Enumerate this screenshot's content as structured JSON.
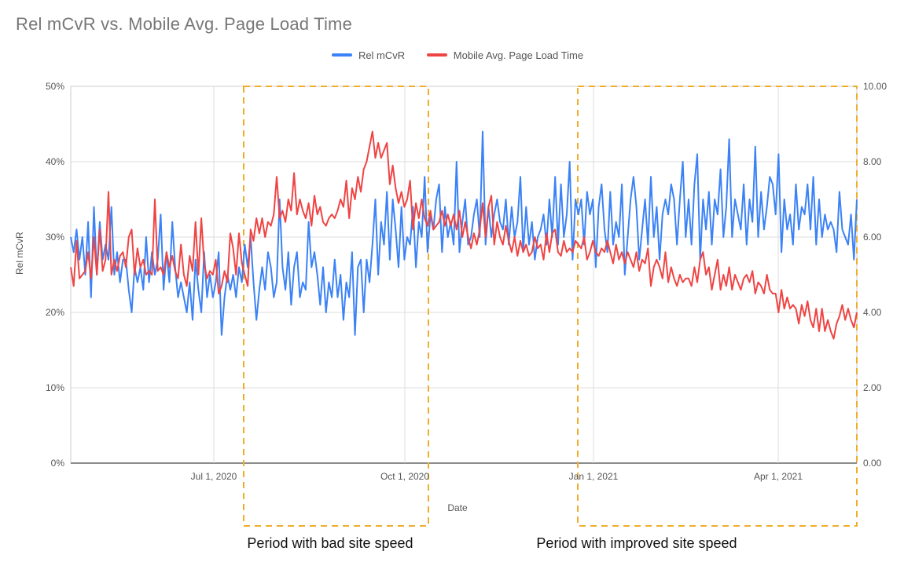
{
  "chart_data": {
    "type": "line",
    "title": "Rel mCvR vs. Mobile Avg. Page Load Time",
    "xlabel": "Date",
    "ylabel": "Rel mCvR",
    "y2label": "",
    "x_ticks": [
      "Jul 1, 2020",
      "Oct 1, 2020",
      "Jan 1, 2021",
      "Apr 1, 2021"
    ],
    "x_tick_pos": [
      0.182,
      0.425,
      0.665,
      0.9
    ],
    "y_ticks": [
      "0%",
      "10%",
      "20%",
      "30%",
      "40%",
      "50%"
    ],
    "ylim": [
      0,
      50
    ],
    "y2_ticks": [
      "0.00",
      "2.00",
      "4.00",
      "6.00",
      "8.00",
      "10.00"
    ],
    "y2lim": [
      0,
      10
    ],
    "legend": [
      "Rel mCvR",
      "Mobile Avg. Page Load Time"
    ],
    "legend_colors": [
      "#3b82f6",
      "#ef4444"
    ],
    "annotations_dashed_color": "#f0ad2b",
    "periods": [
      {
        "label": "Period with bad site speed",
        "x0": 0.22,
        "x1": 0.455
      },
      {
        "label": "Period with improved site speed",
        "x0": 0.645,
        "x1": 1.0
      }
    ],
    "series": [
      {
        "name": "Rel mCvR",
        "color": "#3b82f6",
        "unit": "percent",
        "values": [
          30,
          28,
          31,
          27,
          30,
          25,
          32,
          22,
          34,
          25,
          32,
          27,
          29,
          27,
          34,
          25,
          28,
          24,
          27,
          27,
          23,
          20,
          26,
          24,
          26,
          23,
          30,
          24,
          28,
          25,
          27,
          33,
          23,
          28,
          24,
          32,
          26,
          22,
          24,
          22,
          20,
          24,
          19,
          27,
          23,
          20,
          28,
          22,
          25,
          22,
          24,
          28,
          17,
          22,
          25,
          23,
          25,
          22,
          26,
          24,
          29,
          26,
          30,
          24,
          19,
          23,
          26,
          23,
          28,
          26,
          22,
          24,
          35,
          26,
          23,
          28,
          21,
          26,
          28,
          22,
          24,
          23,
          32,
          26,
          28,
          25,
          21,
          26,
          20,
          24,
          22,
          27,
          22,
          25,
          19,
          24,
          22,
          28,
          17,
          26,
          27,
          20,
          27,
          24,
          29,
          35,
          25,
          32,
          29,
          36,
          27,
          35,
          31,
          26,
          34,
          27,
          30,
          29,
          34,
          26,
          32,
          30,
          38,
          28,
          33,
          31,
          35,
          37,
          28,
          34,
          30,
          32,
          29,
          40,
          28,
          32,
          35,
          29,
          30,
          33,
          35,
          30,
          44,
          29,
          34,
          30,
          33,
          35,
          32,
          31,
          35,
          29,
          34,
          30,
          32,
          38,
          28,
          34,
          29,
          32,
          27,
          30,
          31,
          33,
          29,
          35,
          30,
          38,
          29,
          37,
          30,
          33,
          40,
          27,
          35,
          33,
          35,
          29,
          36,
          33,
          35,
          26,
          34,
          37,
          31,
          28,
          36,
          29,
          32,
          30,
          37,
          25,
          30,
          35,
          38,
          34,
          27,
          31,
          35,
          29,
          38,
          30,
          34,
          27,
          33,
          35,
          33,
          37,
          35,
          29,
          35,
          40,
          30,
          35,
          29,
          37,
          41,
          27,
          35,
          31,
          36,
          29,
          35,
          33,
          39,
          30,
          34,
          43,
          30,
          35,
          33,
          31,
          37,
          29,
          35,
          32,
          42,
          30,
          36,
          31,
          34,
          38,
          37,
          33,
          41,
          28,
          35,
          31,
          33,
          29,
          37,
          31,
          34,
          33,
          37,
          31,
          38,
          29,
          35,
          30,
          33,
          31,
          32,
          31,
          28,
          36,
          31,
          30,
          29,
          33,
          27,
          35
        ]
      },
      {
        "name": "Mobile Avg. Page Load Time",
        "color": "#ef4444",
        "unit": "seconds",
        "values": [
          5.2,
          4.7,
          5.9,
          4.9,
          5.0,
          5.1,
          5.6,
          4.9,
          6.0,
          5.0,
          6.2,
          5.1,
          5.4,
          7.2,
          5.0,
          5.4,
          5.1,
          5.5,
          5.6,
          5.2,
          6.0,
          6.2,
          5.0,
          5.7,
          5.2,
          5.4,
          5.0,
          5.1,
          5.0,
          7.0,
          5.1,
          5.2,
          5.0,
          5.6,
          5.2,
          5.5,
          5.1,
          4.9,
          5.8,
          5.0,
          4.7,
          5.5,
          5.1,
          6.4,
          5.0,
          6.5,
          5.3,
          4.9,
          5.1,
          5.0,
          5.4,
          4.5,
          4.7,
          5.1,
          4.8,
          6.1,
          5.7,
          5.0,
          6.1,
          5.3,
          5.0,
          4.7,
          6.2,
          5.9,
          6.5,
          6.1,
          6.5,
          6.0,
          6.4,
          6.3,
          6.6,
          7.6,
          6.5,
          6.7,
          6.4,
          7.0,
          6.7,
          7.7,
          6.6,
          7.0,
          6.7,
          6.5,
          6.9,
          6.3,
          7.1,
          6.6,
          6.8,
          6.4,
          6.3,
          6.5,
          6.6,
          6.5,
          6.7,
          7.0,
          6.8,
          7.5,
          6.5,
          7.3,
          7.0,
          7.6,
          7.2,
          7.8,
          8.0,
          8.4,
          8.8,
          8.1,
          8.5,
          8.1,
          8.3,
          8.5,
          7.4,
          7.9,
          7.3,
          6.9,
          7.2,
          6.8,
          7.0,
          7.5,
          6.2,
          6.9,
          6.5,
          7.0,
          6.5,
          6.3,
          6.7,
          6.2,
          6.3,
          6.4,
          6.7,
          6.3,
          6.6,
          6.3,
          6.6,
          6.2,
          6.7,
          6.0,
          6.4,
          6.0,
          5.7,
          6.1,
          5.8,
          6.2,
          6.9,
          6.0,
          6.8,
          7.1,
          5.8,
          6.4,
          6.0,
          5.8,
          6.3,
          5.9,
          5.6,
          6.0,
          5.5,
          5.9,
          5.6,
          5.8,
          5.5,
          5.6,
          6.0,
          5.7,
          5.8,
          5.4,
          6.1,
          5.6,
          6.1,
          6.2,
          5.6,
          5.5,
          5.9,
          5.6,
          5.7,
          5.6,
          5.9,
          5.8,
          5.7,
          6.0,
          5.4,
          5.6,
          5.9,
          5.6,
          5.5,
          5.7,
          5.6,
          5.9,
          5.6,
          5.3,
          5.8,
          5.4,
          5.6,
          5.3,
          5.6,
          5.4,
          5.2,
          5.6,
          5.1,
          5.4,
          5.3,
          5.7,
          4.7,
          5.2,
          5.4,
          5.2,
          4.9,
          5.6,
          4.8,
          5.2,
          4.9,
          4.7,
          5.0,
          4.8,
          4.9,
          4.9,
          4.7,
          5.2,
          4.8,
          5.4,
          5.6,
          5.0,
          5.2,
          4.6,
          5.0,
          5.4,
          4.6,
          5.0,
          4.7,
          5.2,
          4.6,
          5.0,
          4.8,
          4.6,
          4.9,
          5.0,
          4.8,
          5.1,
          4.5,
          4.8,
          4.7,
          4.5,
          5.0,
          4.6,
          4.5,
          4.5,
          4.0,
          4.6,
          4.1,
          4.4,
          4.1,
          4.2,
          4.1,
          3.7,
          4.2,
          3.9,
          4.3,
          3.8,
          3.6,
          4.1,
          3.5,
          4.1,
          3.5,
          3.8,
          3.5,
          3.3,
          3.7,
          3.9,
          4.2,
          3.8,
          4.1,
          3.8,
          3.6,
          4.0
        ]
      }
    ]
  }
}
